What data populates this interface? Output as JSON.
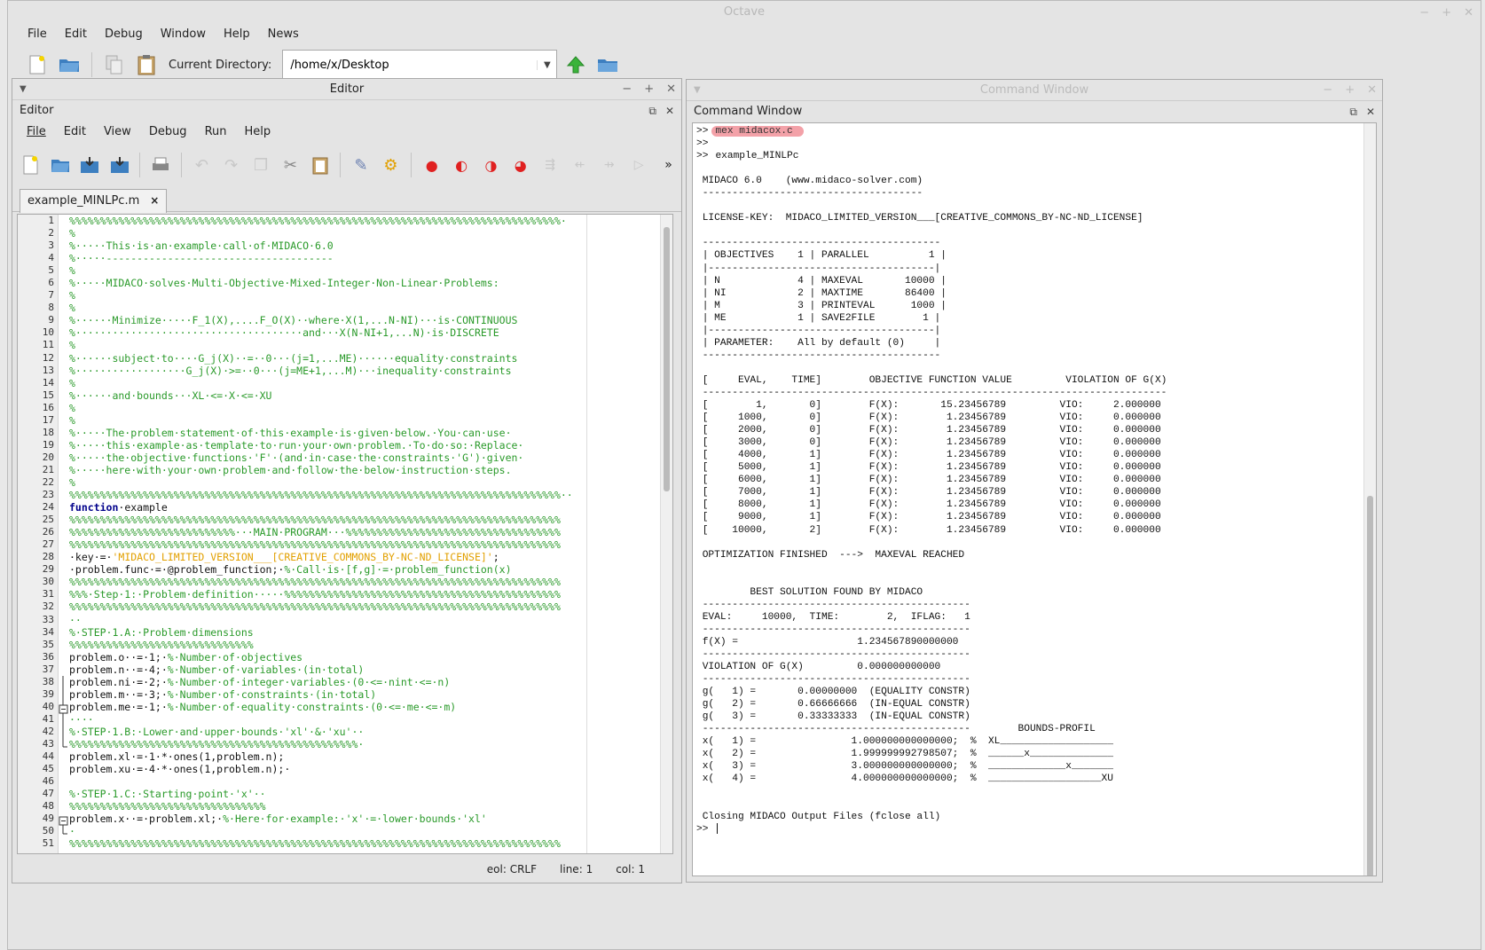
{
  "app": {
    "title": "Octave"
  },
  "menubar": [
    "File",
    "Edit",
    "Debug",
    "Window",
    "Help",
    "News"
  ],
  "toolbar": {
    "current_dir_label": "Current Directory:",
    "current_dir_value": "/home/x/Desktop"
  },
  "editor_panel": {
    "title": "Editor",
    "header": "Editor",
    "menu": [
      "File",
      "Edit",
      "View",
      "Debug",
      "Run",
      "Help"
    ],
    "tab_label": "example_MINLPc.m",
    "tab_close": "×",
    "status": {
      "eol": "eol:",
      "eol_value": "CRLF",
      "line": "line:",
      "line_value": "1",
      "col": "col:",
      "col_value": "1"
    }
  },
  "command_panel": {
    "title": "Command Window",
    "header": "Command Window"
  },
  "code_lines": [
    "%%%%%%%%%%%%%%%%%%%%%%%%%%%%%%%%%%%%%%%%%%%%%%%%%%%%%%%%%%%%%%%%%%%%%%%%%%%%%%%%·",
    "%",
    "%·····This·is·an·example·call·of·MIDACO·6.0",
    "%·····-------------------------------------",
    "%",
    "%·····MIDACO·solves·Multi-Objective·Mixed-Integer·Non-Linear·Problems:",
    "%",
    "%",
    "%······Minimize·····F_1(X),....F_O(X)··where·X(1,...N-NI)···is·CONTINUOUS",
    "%·····································and···X(N-NI+1,...N)·is·DISCRETE",
    "%",
    "%······subject·to····G_j(X)··=··0···(j=1,...ME)······equality·constraints",
    "%··················G_j(X)·>=··0···(j=ME+1,...M)···inequality·constraints",
    "%",
    "%······and·bounds···XL·<=·X·<=·XU",
    "%",
    "%",
    "%·····The·problem·statement·of·this·example·is·given·below.·You·can·use·",
    "%·····this·example·as·template·to·run·your·own·problem.·To·do·so:·Replace·",
    "%·····the·objective·functions·'F'·(and·in·case·the·constraints·'G')·given·",
    "%·····here·with·your·own·problem·and·follow·the·below·instruction·steps.",
    "%",
    "%%%%%%%%%%%%%%%%%%%%%%%%%%%%%%%%%%%%%%%%%%%%%%%%%%%%%%%%%%%%%%%%%%%%%%%%%%%%%%%%··",
    "function·example",
    "%%%%%%%%%%%%%%%%%%%%%%%%%%%%%%%%%%%%%%%%%%%%%%%%%%%%%%%%%%%%%%%%%%%%%%%%%%%%%%%%",
    "%%%%%%%%%%%%%%%%%%%%%%%%%%%···MAIN·PROGRAM···%%%%%%%%%%%%%%%%%%%%%%%%%%%%%%%%%%%",
    "%%%%%%%%%%%%%%%%%%%%%%%%%%%%%%%%%%%%%%%%%%%%%%%%%%%%%%%%%%%%%%%%%%%%%%%%%%%%%%%%",
    "·key·=·'MIDACO_LIMITED_VERSION___[CREATIVE_COMMONS_BY-NC-ND_LICENSE]';",
    "·problem.func·=·@problem_function;·%·Call·is·[f,g]·=·problem_function(x)",
    "%%%%%%%%%%%%%%%%%%%%%%%%%%%%%%%%%%%%%%%%%%%%%%%%%%%%%%%%%%%%%%%%%%%%%%%%%%%%%%%%",
    "%%%·Step·1:·Problem·definition·····%%%%%%%%%%%%%%%%%%%%%%%%%%%%%%%%%%%%%%%%%%%%%",
    "%%%%%%%%%%%%%%%%%%%%%%%%%%%%%%%%%%%%%%%%%%%%%%%%%%%%%%%%%%%%%%%%%%%%%%%%%%%%%%%%",
    "··",
    "%·STEP·1.A:·Problem·dimensions",
    "%%%%%%%%%%%%%%%%%%%%%%%%%%%%%%",
    "problem.o··=·1;·%·Number·of·objectives",
    "problem.n··=·4;·%·Number·of·variables·(in·total)",
    "problem.ni·=·2;·%·Number·of·integer·variables·(0·<=·nint·<=·n)",
    "problem.m··=·3;·%·Number·of·constraints·(in·total)",
    "problem.me·=·1;·%·Number·of·equality·constraints·(0·<=·me·<=·m)",
    "····",
    "%·STEP·1.B:·Lower·and·upper·bounds·'xl'·&·'xu'··",
    "%%%%%%%%%%%%%%%%%%%%%%%%%%%%%%%%%%%%%%%%%%%%%%%·",
    "problem.xl·=·1·*·ones(1,problem.n);",
    "problem.xu·=·4·*·ones(1,problem.n);·",
    "",
    "%·STEP·1.C:·Starting·point·'x'··",
    "%%%%%%%%%%%%%%%%%%%%%%%%%%%%%%%%",
    "problem.x··=·problem.xl;·%·Here·for·example:·'x'·=·lower·bounds·'xl'",
    "·",
    "%%%%%%%%%%%%%%%%%%%%%%%%%%%%%%%%%%%%%%%%%%%%%%%%%%%%%%%%%%%%%%%%%%%%%%%%%%%%%%%%"
  ],
  "command_lines": [
    {
      "p": ">>",
      "t": "mex midacox.c",
      "hl": true
    },
    {
      "p": ">>",
      "t": ""
    },
    {
      "p": ">>",
      "t": "example_MINLPc"
    },
    {
      "p": "",
      "t": ""
    },
    {
      "p": "",
      "t": " MIDACO 6.0    (www.midaco-solver.com)"
    },
    {
      "p": "",
      "t": " -------------------------------------"
    },
    {
      "p": "",
      "t": ""
    },
    {
      "p": "",
      "t": " LICENSE-KEY:  MIDACO_LIMITED_VERSION___[CREATIVE_COMMONS_BY-NC-ND_LICENSE]"
    },
    {
      "p": "",
      "t": ""
    },
    {
      "p": "",
      "t": " ----------------------------------------"
    },
    {
      "p": "",
      "t": " | OBJECTIVES    1 | PARALLEL          1 |"
    },
    {
      "p": "",
      "t": " |--------------------------------------|"
    },
    {
      "p": "",
      "t": " | N             4 | MAXEVAL       10000 |"
    },
    {
      "p": "",
      "t": " | NI            2 | MAXTIME       86400 |"
    },
    {
      "p": "",
      "t": " | M             3 | PRINTEVAL      1000 |"
    },
    {
      "p": "",
      "t": " | ME            1 | SAVE2FILE        1 |"
    },
    {
      "p": "",
      "t": " |--------------------------------------|"
    },
    {
      "p": "",
      "t": " | PARAMETER:    All by default (0)     |"
    },
    {
      "p": "",
      "t": " ----------------------------------------"
    },
    {
      "p": "",
      "t": ""
    },
    {
      "p": "",
      "t": " [     EVAL,    TIME]        OBJECTIVE FUNCTION VALUE         VIOLATION OF G(X)"
    },
    {
      "p": "",
      "t": " ------------------------------------------------------------------------------"
    },
    {
      "p": "",
      "t": " [        1,       0]        F(X):       15.23456789         VIO:     2.000000"
    },
    {
      "p": "",
      "t": " [     1000,       0]        F(X):        1.23456789         VIO:     0.000000"
    },
    {
      "p": "",
      "t": " [     2000,       0]        F(X):        1.23456789         VIO:     0.000000"
    },
    {
      "p": "",
      "t": " [     3000,       0]        F(X):        1.23456789         VIO:     0.000000"
    },
    {
      "p": "",
      "t": " [     4000,       1]        F(X):        1.23456789         VIO:     0.000000"
    },
    {
      "p": "",
      "t": " [     5000,       1]        F(X):        1.23456789         VIO:     0.000000"
    },
    {
      "p": "",
      "t": " [     6000,       1]        F(X):        1.23456789         VIO:     0.000000"
    },
    {
      "p": "",
      "t": " [     7000,       1]        F(X):        1.23456789         VIO:     0.000000"
    },
    {
      "p": "",
      "t": " [     8000,       1]        F(X):        1.23456789         VIO:     0.000000"
    },
    {
      "p": "",
      "t": " [     9000,       1]        F(X):        1.23456789         VIO:     0.000000"
    },
    {
      "p": "",
      "t": " [    10000,       2]        F(X):        1.23456789         VIO:     0.000000"
    },
    {
      "p": "",
      "t": ""
    },
    {
      "p": "",
      "t": " OPTIMIZATION FINISHED  --->  MAXEVAL REACHED"
    },
    {
      "p": "",
      "t": ""
    },
    {
      "p": "",
      "t": ""
    },
    {
      "p": "",
      "t": "         BEST SOLUTION FOUND BY MIDACO"
    },
    {
      "p": "",
      "t": " ---------------------------------------------"
    },
    {
      "p": "",
      "t": " EVAL:     10000,  TIME:        2,  IFLAG:   1"
    },
    {
      "p": "",
      "t": " ---------------------------------------------"
    },
    {
      "p": "",
      "t": " f(X) =                    1.234567890000000"
    },
    {
      "p": "",
      "t": " ---------------------------------------------"
    },
    {
      "p": "",
      "t": " VIOLATION OF G(X)         0.000000000000"
    },
    {
      "p": "",
      "t": " ---------------------------------------------"
    },
    {
      "p": "",
      "t": " g(   1) =       0.00000000  (EQUALITY CONSTR)"
    },
    {
      "p": "",
      "t": " g(   2) =       0.66666666  (IN-EQUAL CONSTR)"
    },
    {
      "p": "",
      "t": " g(   3) =       0.33333333  (IN-EQUAL CONSTR)"
    },
    {
      "p": "",
      "t": " ---------------------------------------------        BOUNDS-PROFIL"
    },
    {
      "p": "",
      "t": " x(   1) =                1.000000000000000;  %  XL___________________"
    },
    {
      "p": "",
      "t": " x(   2) =                1.999999992798507;  %  ______x______________"
    },
    {
      "p": "",
      "t": " x(   3) =                3.000000000000000;  %  _____________x_______"
    },
    {
      "p": "",
      "t": " x(   4) =                4.000000000000000;  %  ___________________XU"
    },
    {
      "p": "",
      "t": ""
    },
    {
      "p": "",
      "t": ""
    },
    {
      "p": "",
      "t": " Closing MIDACO Output Files (fclose all)"
    },
    {
      "p": ">>",
      "t": "",
      "caret": true
    }
  ]
}
